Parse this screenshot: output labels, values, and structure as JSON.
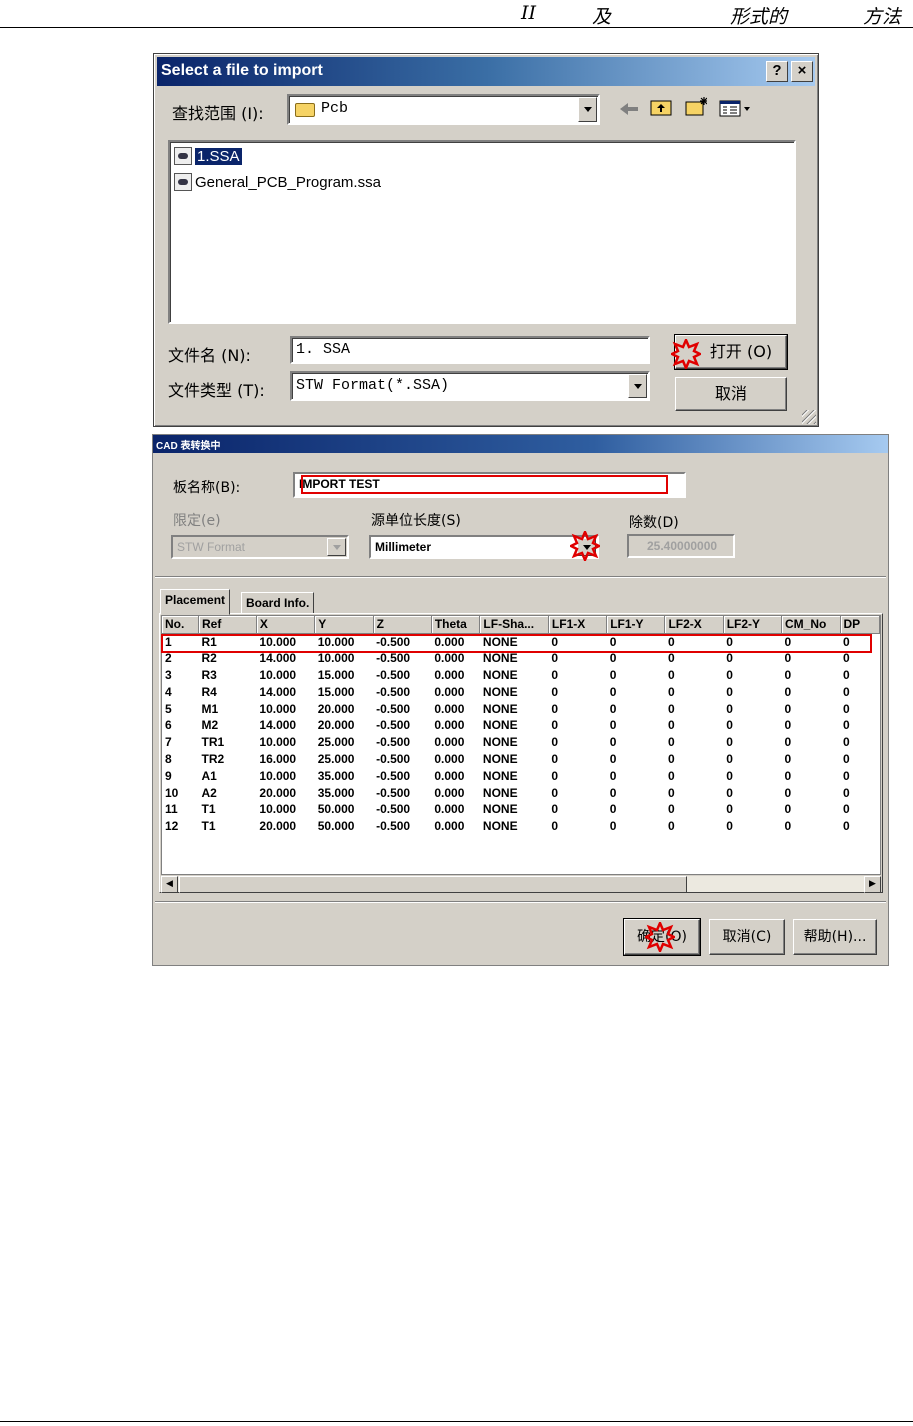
{
  "page_header": {
    "parts": [
      "II",
      "及",
      "形式的",
      "方法"
    ]
  },
  "file_dialog": {
    "title": "Select a file to import",
    "help_button": "?",
    "close_button": "×",
    "look_in_label": "查找范围 (I):",
    "look_in_value": "Pcb",
    "files": [
      {
        "name": "1.SSA",
        "selected": true
      },
      {
        "name": "General_PCB_Program.ssa",
        "selected": false
      }
    ],
    "filename_label": "文件名 (N):",
    "filename_value": "1. SSA",
    "filetype_label": "文件类型 (T):",
    "filetype_value": "STW Format(*.SSA)",
    "open_button": "打开 (O)",
    "cancel_button": "取消",
    "toolbar_icons": [
      "back-icon",
      "up-folder-icon",
      "new-folder-icon",
      "view-menu-icon"
    ]
  },
  "cad_dialog": {
    "title": "CAD 表转换中",
    "board_name_label": "板名称(B):",
    "board_name_value": "IMPORT TEST",
    "limit_label": "限定(e)",
    "limit_value": "STW Format",
    "source_unit_label": "源单位长度(S)",
    "source_unit_value": "Millimeter",
    "divisor_label": "除数(D)",
    "divisor_value": "25.40000000",
    "tabs": [
      "Placement",
      "Board Info."
    ],
    "columns": [
      "No.",
      "Ref",
      "X",
      "Y",
      "Z",
      "Theta",
      "LF-Sha...",
      "LF1-X",
      "LF1-Y",
      "LF2-X",
      "LF2-Y",
      "CM_No",
      "DP"
    ],
    "rows": [
      [
        "1",
        "R1",
        "10.000",
        "10.000",
        "-0.500",
        "0.000",
        "NONE",
        "0",
        "0",
        "0",
        "0",
        "0",
        "0"
      ],
      [
        "2",
        "R2",
        "14.000",
        "10.000",
        "-0.500",
        "0.000",
        "NONE",
        "0",
        "0",
        "0",
        "0",
        "0",
        "0"
      ],
      [
        "3",
        "R3",
        "10.000",
        "15.000",
        "-0.500",
        "0.000",
        "NONE",
        "0",
        "0",
        "0",
        "0",
        "0",
        "0"
      ],
      [
        "4",
        "R4",
        "14.000",
        "15.000",
        "-0.500",
        "0.000",
        "NONE",
        "0",
        "0",
        "0",
        "0",
        "0",
        "0"
      ],
      [
        "5",
        "M1",
        "10.000",
        "20.000",
        "-0.500",
        "0.000",
        "NONE",
        "0",
        "0",
        "0",
        "0",
        "0",
        "0"
      ],
      [
        "6",
        "M2",
        "14.000",
        "20.000",
        "-0.500",
        "0.000",
        "NONE",
        "0",
        "0",
        "0",
        "0",
        "0",
        "0"
      ],
      [
        "7",
        "TR1",
        "10.000",
        "25.000",
        "-0.500",
        "0.000",
        "NONE",
        "0",
        "0",
        "0",
        "0",
        "0",
        "0"
      ],
      [
        "8",
        "TR2",
        "16.000",
        "25.000",
        "-0.500",
        "0.000",
        "NONE",
        "0",
        "0",
        "0",
        "0",
        "0",
        "0"
      ],
      [
        "9",
        "A1",
        "10.000",
        "35.000",
        "-0.500",
        "0.000",
        "NONE",
        "0",
        "0",
        "0",
        "0",
        "0",
        "0"
      ],
      [
        "10",
        "A2",
        "20.000",
        "35.000",
        "-0.500",
        "0.000",
        "NONE",
        "0",
        "0",
        "0",
        "0",
        "0",
        "0"
      ],
      [
        "11",
        "T1",
        "10.000",
        "50.000",
        "-0.500",
        "0.000",
        "NONE",
        "0",
        "0",
        "0",
        "0",
        "0",
        "0"
      ],
      [
        "12",
        "T1",
        "20.000",
        "50.000",
        "-0.500",
        "0.000",
        "NONE",
        "0",
        "0",
        "0",
        "0",
        "0",
        "0"
      ]
    ],
    "ok_button": "确定(O)",
    "cancel_button": "取消(C)",
    "help_button": "帮助(H)..."
  },
  "colors": {
    "titlebar_start": "#0a246a",
    "titlebar_end": "#a6caf0",
    "dialog_face": "#d4d0c8",
    "annotation_red": "#e00000",
    "selection": "#0a246a"
  }
}
